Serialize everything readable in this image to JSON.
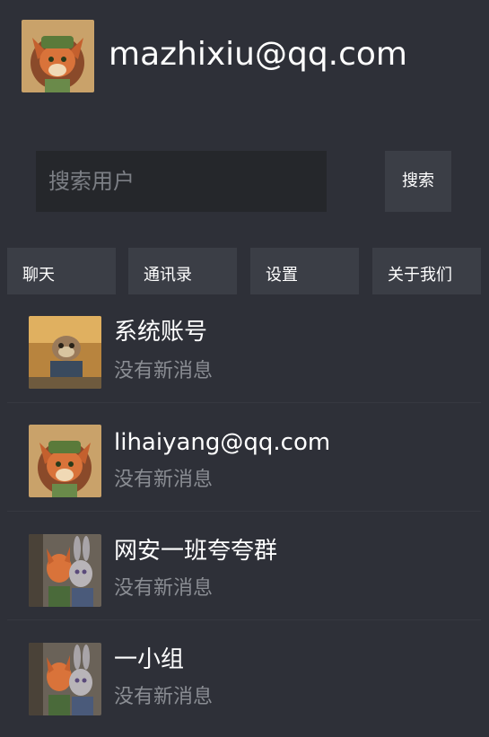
{
  "header": {
    "email": "mazhixiu@qq.com",
    "avatar_icon": "fox-avatar-icon"
  },
  "search": {
    "placeholder": "搜索用户",
    "value": "",
    "button_label": "搜索"
  },
  "tabs": [
    {
      "label": "聊天"
    },
    {
      "label": "通讯录"
    },
    {
      "label": "设置"
    },
    {
      "label": "关于我们"
    }
  ],
  "chats": [
    {
      "name": "系统账号",
      "status": "没有新消息",
      "avatar_icon": "sloth-avatar-icon"
    },
    {
      "name": "lihaiyang@qq.com",
      "status": "没有新消息",
      "avatar_icon": "fox-avatar-icon"
    },
    {
      "name": "网安一班夸夸群",
      "status": "没有新消息",
      "avatar_icon": "group-avatar-icon"
    },
    {
      "name": "一小组",
      "status": "没有新消息",
      "avatar_icon": "group-avatar-icon"
    }
  ],
  "colors": {
    "background": "#2e3038",
    "input_background": "#25272b",
    "button_background": "#3b3e46",
    "muted_text": "#8a8d93"
  }
}
